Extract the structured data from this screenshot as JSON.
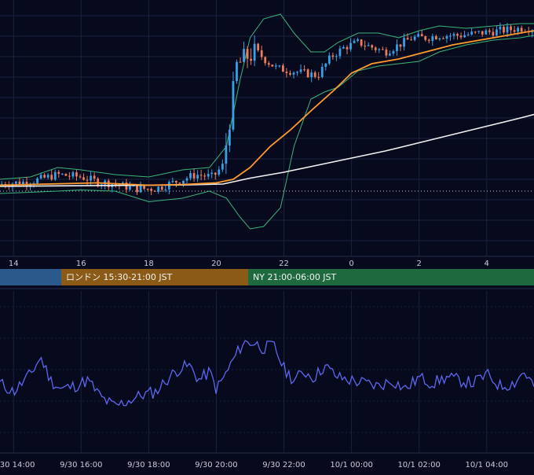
{
  "colors": {
    "background": "#060a1c",
    "grid": "#1b2140",
    "candle_up": "#3aa0e6",
    "candle_down": "#f07a5a",
    "bollinger": "#3bb57a",
    "ma_short": "#ff9a2e",
    "ma_long": "#f2f2f2",
    "oscillator": "#5f67f0",
    "session_tokyo": "#2a5a8c",
    "session_london": "#8a5a16",
    "session_ny": "#1e6a3e"
  },
  "sessions": [
    {
      "label": "",
      "color": "#2a5a8c"
    },
    {
      "label": "ロンドン 15:30-21:00 JST",
      "color": "#8a5a16"
    },
    {
      "label": "NY 21:00-06:00 JST",
      "color": "#1e6a3e"
    }
  ],
  "chart_data": [
    {
      "type": "candlestick",
      "x_ticks": [
        "14",
        "16",
        "18",
        "20",
        "22",
        "0",
        "2",
        "4"
      ],
      "x_tick_hours": [
        14,
        16,
        18,
        20,
        22,
        24,
        26,
        28
      ],
      "x_range_hours": [
        13.6,
        29.4
      ],
      "y_range": [
        0,
        100
      ],
      "grid": true,
      "price_path": [
        [
          13.6,
          24
        ],
        [
          14.5,
          25
        ],
        [
          15.3,
          28
        ],
        [
          16.0,
          27
        ],
        [
          16.5,
          25
        ],
        [
          17.0,
          24
        ],
        [
          17.6,
          22
        ],
        [
          18.2,
          22
        ],
        [
          18.8,
          25
        ],
        [
          19.4,
          28
        ],
        [
          19.9,
          27
        ],
        [
          20.2,
          32
        ],
        [
          20.4,
          52
        ],
        [
          20.6,
          74
        ],
        [
          20.9,
          78
        ],
        [
          21.2,
          80
        ],
        [
          21.5,
          76
        ],
        [
          21.8,
          73
        ],
        [
          22.2,
          72
        ],
        [
          22.6,
          71
        ],
        [
          23.0,
          70
        ],
        [
          23.4,
          78
        ],
        [
          23.8,
          82
        ],
        [
          24.2,
          84
        ],
        [
          24.6,
          82
        ],
        [
          25.0,
          80
        ],
        [
          25.4,
          83
        ],
        [
          25.8,
          86
        ],
        [
          26.2,
          86
        ],
        [
          26.6,
          87
        ],
        [
          27.2,
          87
        ],
        [
          27.8,
          88
        ],
        [
          28.4,
          89
        ],
        [
          29.0,
          90
        ],
        [
          29.4,
          90
        ]
      ],
      "ma_short": [
        [
          13.6,
          23.5
        ],
        [
          15.0,
          24
        ],
        [
          16.5,
          24.5
        ],
        [
          18.0,
          23.5
        ],
        [
          19.0,
          23.8
        ],
        [
          20.0,
          24.5
        ],
        [
          20.5,
          26
        ],
        [
          21.0,
          31
        ],
        [
          21.6,
          40
        ],
        [
          22.2,
          47
        ],
        [
          22.8,
          55
        ],
        [
          23.5,
          64
        ],
        [
          24.0,
          71
        ],
        [
          24.6,
          75
        ],
        [
          25.4,
          77
        ],
        [
          26.2,
          80
        ],
        [
          27.0,
          83
        ],
        [
          27.8,
          85
        ],
        [
          28.6,
          87
        ],
        [
          29.4,
          89
        ]
      ],
      "ma_long": [
        [
          13.6,
          23
        ],
        [
          15.0,
          23.2
        ],
        [
          17.0,
          23.4
        ],
        [
          19.0,
          23.6
        ],
        [
          20.2,
          24
        ],
        [
          21.0,
          26.5
        ],
        [
          22.0,
          29
        ],
        [
          23.0,
          32
        ],
        [
          24.0,
          35
        ],
        [
          25.0,
          38
        ],
        [
          26.0,
          41.5
        ],
        [
          27.0,
          45
        ],
        [
          28.0,
          48.5
        ],
        [
          29.0,
          52
        ],
        [
          29.4,
          53.5
        ]
      ],
      "bollinger_upper": [
        [
          13.6,
          26
        ],
        [
          14.5,
          27
        ],
        [
          15.3,
          31
        ],
        [
          16.0,
          30
        ],
        [
          17.0,
          28
        ],
        [
          18.0,
          27
        ],
        [
          19.0,
          30
        ],
        [
          19.8,
          31
        ],
        [
          20.3,
          40
        ],
        [
          20.7,
          68
        ],
        [
          21.0,
          86
        ],
        [
          21.4,
          94
        ],
        [
          21.9,
          96
        ],
        [
          22.3,
          88
        ],
        [
          22.8,
          80
        ],
        [
          23.2,
          80
        ],
        [
          23.6,
          84
        ],
        [
          24.2,
          88
        ],
        [
          24.8,
          88
        ],
        [
          25.4,
          86
        ],
        [
          26.0,
          89
        ],
        [
          26.6,
          91
        ],
        [
          27.4,
          90
        ],
        [
          28.2,
          91
        ],
        [
          29.0,
          92
        ],
        [
          29.4,
          92
        ]
      ],
      "bollinger_lower": [
        [
          13.6,
          20
        ],
        [
          14.5,
          20.5
        ],
        [
          15.3,
          21
        ],
        [
          16.0,
          21.5
        ],
        [
          17.0,
          21
        ],
        [
          18.0,
          16.5
        ],
        [
          19.0,
          18
        ],
        [
          19.8,
          21
        ],
        [
          20.3,
          18
        ],
        [
          20.7,
          10
        ],
        [
          21.0,
          5
        ],
        [
          21.4,
          6
        ],
        [
          21.9,
          14
        ],
        [
          22.3,
          40
        ],
        [
          22.8,
          60
        ],
        [
          23.2,
          63
        ],
        [
          23.6,
          65
        ],
        [
          24.2,
          72
        ],
        [
          24.8,
          74
        ],
        [
          25.4,
          75
        ],
        [
          26.0,
          76
        ],
        [
          26.6,
          80
        ],
        [
          27.4,
          83
        ],
        [
          28.2,
          85
        ],
        [
          29.0,
          86
        ],
        [
          29.4,
          87
        ]
      ],
      "reference_level": 21
    },
    {
      "type": "line",
      "x_ticks": [
        "9/30 14:00",
        "9/30 16:00",
        "9/30 18:00",
        "9/30 20:00",
        "9/30 22:00",
        "10/1 00:00",
        "10/1 02:00",
        "10/1 04:00"
      ],
      "x_tick_hours": [
        14,
        16,
        18,
        20,
        22,
        24,
        26,
        28
      ],
      "x_range_hours": [
        13.6,
        29.4
      ],
      "y_range": [
        0,
        100
      ],
      "grid": true,
      "series": [
        {
          "values": [
            [
              13.6,
              42
            ],
            [
              14.0,
              36
            ],
            [
              14.5,
              48
            ],
            [
              14.8,
              60
            ],
            [
              15.1,
              44
            ],
            [
              15.4,
              38
            ],
            [
              15.8,
              40
            ],
            [
              16.2,
              44
            ],
            [
              16.6,
              32
            ],
            [
              17.0,
              26
            ],
            [
              17.4,
              30
            ],
            [
              17.8,
              34
            ],
            [
              18.2,
              36
            ],
            [
              18.6,
              46
            ],
            [
              18.9,
              52
            ],
            [
              19.2,
              54
            ],
            [
              19.5,
              44
            ],
            [
              19.8,
              50
            ],
            [
              20.0,
              38
            ],
            [
              20.2,
              45
            ],
            [
              20.5,
              58
            ],
            [
              20.8,
              70
            ],
            [
              21.1,
              70
            ],
            [
              21.4,
              66
            ],
            [
              21.7,
              68
            ],
            [
              22.0,
              52
            ],
            [
              22.3,
              44
            ],
            [
              22.6,
              50
            ],
            [
              22.9,
              46
            ],
            [
              23.2,
              54
            ],
            [
              23.6,
              46
            ],
            [
              24.0,
              44
            ],
            [
              24.4,
              42
            ],
            [
              24.8,
              40
            ],
            [
              25.2,
              44
            ],
            [
              25.6,
              38
            ],
            [
              26.0,
              46
            ],
            [
              26.4,
              42
            ],
            [
              26.8,
              46
            ],
            [
              27.2,
              44
            ],
            [
              27.6,
              42
            ],
            [
              28.0,
              48
            ],
            [
              28.4,
              40
            ],
            [
              28.8,
              42
            ],
            [
              29.1,
              50
            ],
            [
              29.4,
              40
            ]
          ]
        }
      ]
    }
  ]
}
